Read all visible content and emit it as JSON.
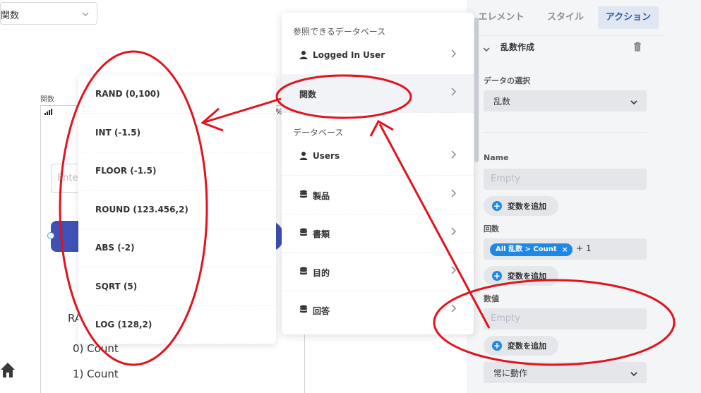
{
  "top_select": {
    "value": "関数"
  },
  "canvas": {
    "label": "関数",
    "battery": "%",
    "input_placeholder": "Ente",
    "text_ra": "RA",
    "count0": "0) Count",
    "count1": "1) Count"
  },
  "function_menu": {
    "items": [
      {
        "label": "RAND (0,100)"
      },
      {
        "label": "INT (-1.5)"
      },
      {
        "label": "FLOOR (-1.5)"
      },
      {
        "label": "ROUND (123.456,2)"
      },
      {
        "label": "ABS (-2)"
      },
      {
        "label": "SQRT (5)"
      },
      {
        "label": "LOG (128,2)"
      }
    ]
  },
  "source_menu": {
    "ref_header": "参照できるデータベース",
    "logged_in_user": "Logged In User",
    "functions": "関数",
    "db_header": "データベース",
    "tables": [
      {
        "label": "Users",
        "icon": "user-icon"
      },
      {
        "label": "製品",
        "icon": "database-icon"
      },
      {
        "label": "書類",
        "icon": "database-icon"
      },
      {
        "label": "目的",
        "icon": "database-icon"
      },
      {
        "label": "回答",
        "icon": "database-icon"
      }
    ]
  },
  "panel": {
    "tabs": {
      "element": "エレメント",
      "style": "スタイル",
      "action": "アクション"
    },
    "action_title": "乱数作成",
    "data_select_label": "データの選択",
    "data_select_value": "乱数",
    "name_label": "Name",
    "name_placeholder": "Empty",
    "add_variable": "変数を追加",
    "count_label": "回数",
    "count_chip": "All 乱数 > Count",
    "count_plus": "+ 1",
    "value_label": "数値",
    "value_placeholder": "Empty",
    "run_select": "常に動作"
  },
  "colors": {
    "accent": "#1e88e5",
    "active_tab_text": "#2f5ea8",
    "active_tab_bg": "#e0e7f2",
    "canvas_button": "#3f51b5",
    "annotation": "#e0141e"
  }
}
